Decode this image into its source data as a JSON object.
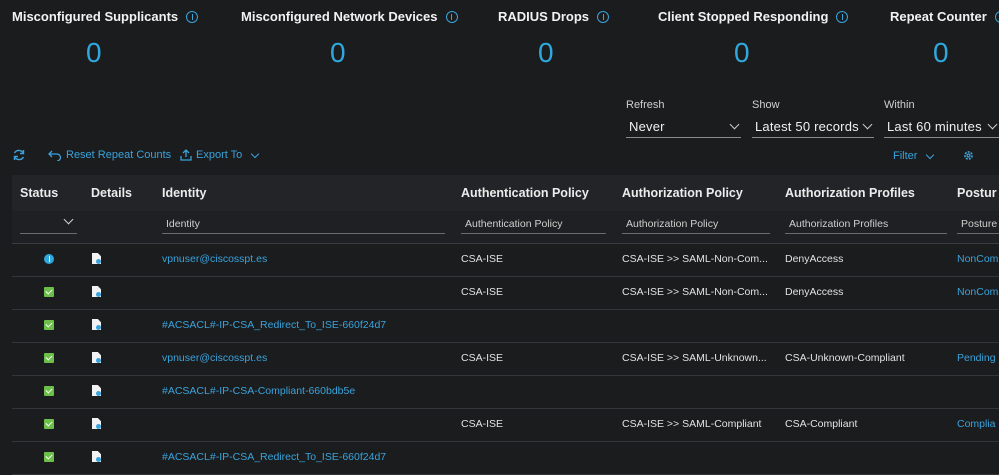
{
  "counters": [
    {
      "title": "Misconfigured Supplicants",
      "value": "0"
    },
    {
      "title": "Misconfigured Network Devices",
      "value": "0"
    },
    {
      "title": "RADIUS Drops",
      "value": "0"
    },
    {
      "title": "Client Stopped Responding",
      "value": "0"
    },
    {
      "title": "Repeat Counter",
      "value": "0"
    }
  ],
  "filters": {
    "refresh": {
      "label": "Refresh",
      "value": "Never"
    },
    "show": {
      "label": "Show",
      "value": "Latest 50 records"
    },
    "within": {
      "label": "Within",
      "value": "Last 60 minutes"
    }
  },
  "toolbar": {
    "reset_label": "Reset Repeat Counts",
    "export_label": "Export To",
    "filter_label": "Filter"
  },
  "table": {
    "headers": [
      "Status",
      "Details",
      "Identity",
      "Authentication Policy",
      "Authorization Policy",
      "Authorization Profiles",
      "Postur"
    ],
    "filter_placeholders": {
      "identity": "Identity",
      "auth_policy": "Authentication Policy",
      "authz_policy": "Authorization Policy",
      "authz_profiles": "Authorization Profiles",
      "posture": "Posture"
    },
    "rows": [
      {
        "status": "info",
        "identity": "vpnuser@ciscosspt.es",
        "auth_policy": "CSA-ISE",
        "authz_policy": "CSA-ISE >> SAML-Non-Com...",
        "authz_profile": "DenyAccess",
        "posture": "NonCom"
      },
      {
        "status": "pass",
        "identity": "",
        "auth_policy": "CSA-ISE",
        "authz_policy": "CSA-ISE >> SAML-Non-Com...",
        "authz_profile": "DenyAccess",
        "posture": "NonCom"
      },
      {
        "status": "pass",
        "identity": "#ACSACL#-IP-CSA_Redirect_To_ISE-660f24d7",
        "auth_policy": "",
        "authz_policy": "",
        "authz_profile": "",
        "posture": ""
      },
      {
        "status": "pass",
        "identity": "vpnuser@ciscosspt.es",
        "auth_policy": "CSA-ISE",
        "authz_policy": "CSA-ISE >> SAML-Unknown...",
        "authz_profile": "CSA-Unknown-Compliant",
        "posture": "Pending"
      },
      {
        "status": "pass",
        "identity": "#ACSACL#-IP-CSA-Compliant-660bdb5e",
        "auth_policy": "",
        "authz_policy": "",
        "authz_profile": "",
        "posture": ""
      },
      {
        "status": "pass",
        "identity": "",
        "auth_policy": "CSA-ISE",
        "authz_policy": "CSA-ISE >> SAML-Compliant",
        "authz_profile": "CSA-Compliant",
        "posture": "Complia"
      },
      {
        "status": "pass",
        "identity": "#ACSACL#-IP-CSA_Redirect_To_ISE-660f24d7",
        "auth_policy": "",
        "authz_policy": "",
        "authz_profile": "",
        "posture": ""
      }
    ]
  },
  "colors": {
    "accent": "#2fa8dd",
    "pass": "#6cc04a",
    "background": "#1b1c1e"
  }
}
